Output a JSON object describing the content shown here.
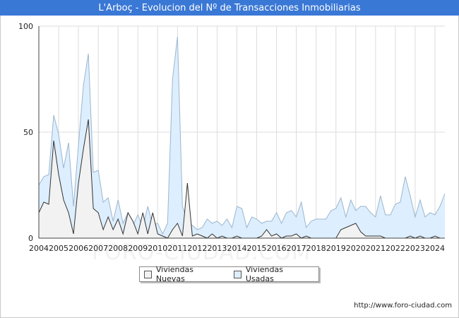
{
  "title": "L'Arboç - Evolucion del Nº de Transacciones Inmobiliarias",
  "credit": "http://www.foro-ciudad.com",
  "watermark": "FORO-CIUDAD.COM",
  "colors": {
    "title_bg": "#3a78d6",
    "nuevas_fill": "#f2f2f2",
    "nuevas_line": "#333333",
    "usadas_fill": "#ddeeff",
    "usadas_line": "#9bb6cc",
    "grid": "#dcdcdc"
  },
  "chart_data": {
    "type": "area",
    "title": "L'Arboç - Evolucion del Nº de Transacciones Inmobiliarias",
    "xlabel": "",
    "ylabel": "",
    "ylim": [
      0,
      100
    ],
    "yticks": [
      0,
      50,
      100
    ],
    "grid": true,
    "legend_position": "bottom",
    "x_ticks": [
      "2004",
      "2005",
      "2006",
      "2007",
      "2008",
      "2009",
      "2010",
      "2011",
      "2012",
      "2013",
      "2014",
      "2015",
      "2016",
      "2017",
      "2018",
      "2019",
      "2020",
      "2021",
      "2022",
      "2023",
      "2024"
    ],
    "x_start": 2004.0,
    "x_step": 0.25,
    "series": [
      {
        "name": "Viviendas Nuevas",
        "values": [
          12,
          17,
          16,
          46,
          30,
          18,
          12,
          2,
          26,
          42,
          56,
          14,
          12,
          4,
          10,
          4,
          9,
          2,
          12,
          8,
          2,
          12,
          2,
          12,
          2,
          1,
          0,
          4,
          7,
          1,
          26,
          1,
          2,
          1,
          0,
          2,
          0,
          1,
          0,
          0,
          1,
          0,
          0,
          0,
          0,
          1,
          4,
          1,
          2,
          0,
          1,
          1,
          2,
          0,
          1,
          0,
          0,
          0,
          0,
          0,
          0,
          4,
          5,
          6,
          7,
          3,
          1,
          1,
          1,
          1,
          0,
          0,
          0,
          0,
          0,
          1,
          0,
          1,
          0,
          0,
          1,
          0,
          0
        ]
      },
      {
        "name": "Viviendas Usadas",
        "values": [
          25,
          29,
          30,
          58,
          49,
          33,
          45,
          15,
          44,
          72,
          87,
          31,
          32,
          17,
          19,
          8,
          18,
          7,
          12,
          6,
          11,
          5,
          15,
          6,
          7,
          2,
          7,
          75,
          95,
          15,
          8,
          6,
          4,
          5,
          9,
          7,
          8,
          6,
          9,
          5,
          15,
          14,
          5,
          10,
          9,
          7,
          8,
          8,
          12,
          7,
          12,
          13,
          10,
          17,
          5,
          8,
          9,
          9,
          9,
          13,
          14,
          19,
          10,
          18,
          13,
          15,
          15,
          12,
          10,
          20,
          11,
          11,
          16,
          17,
          29,
          20,
          10,
          18,
          10,
          12,
          11,
          15,
          21
        ]
      }
    ]
  }
}
